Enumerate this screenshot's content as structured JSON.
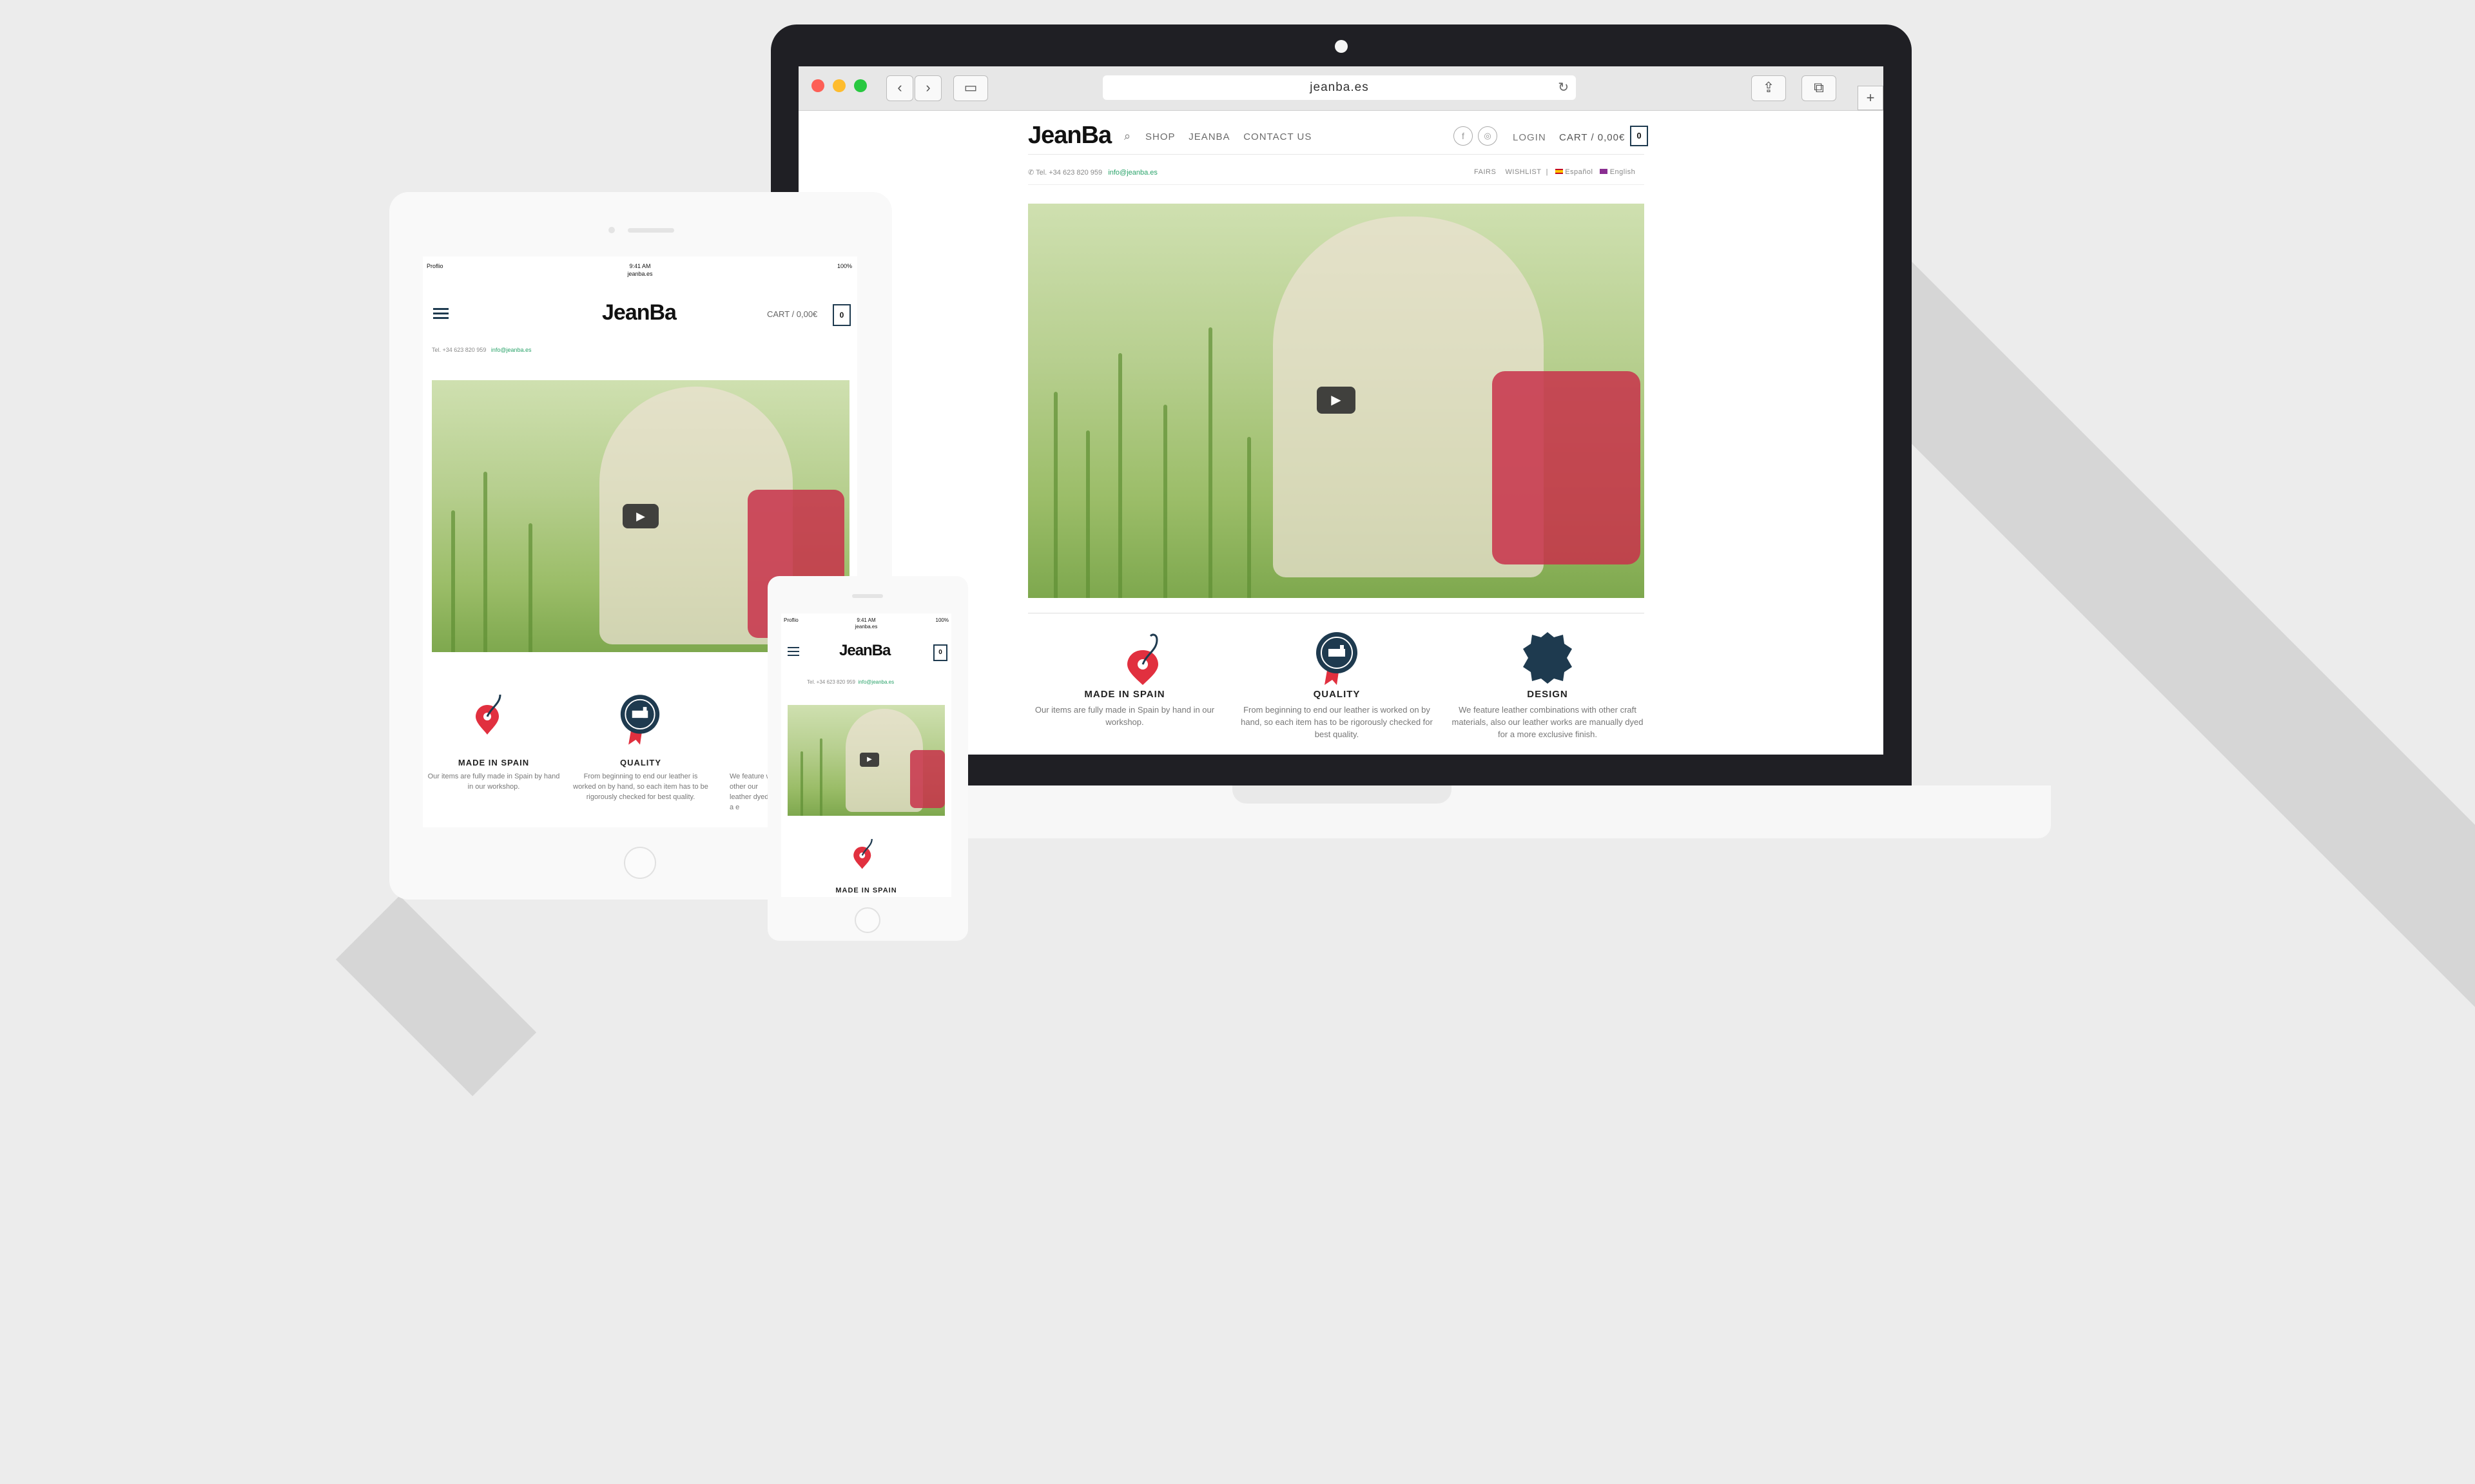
{
  "browser": {
    "url": "jeanba.es",
    "traffic_colors": [
      "#fd5f56",
      "#febc2e",
      "#28c840"
    ]
  },
  "site": {
    "logo": "JeanBa",
    "nav": [
      "SHOP",
      "JEANBA",
      "CONTACT US"
    ],
    "login": "LOGIN",
    "cart_label": "CART / 0,00€",
    "cart_count": "0",
    "phone": "Tel. +34 623 820 959",
    "email": "info@jeanba.es",
    "topbar_links": [
      "FAIRS",
      "WISHLIST"
    ],
    "languages": [
      "Español",
      "English"
    ],
    "features": [
      {
        "icon": "map-pin-needle-icon",
        "title": "MADE IN SPAIN",
        "text": "Our items are fully made in Spain by hand in our workshop."
      },
      {
        "icon": "sewing-badge-icon",
        "title": "QUALITY",
        "text": "From beginning to end our leather is worked on by hand, so each item has to be rigorously checked for best quality."
      },
      {
        "icon": "leather-hide-icon",
        "title": "DESIGN",
        "text": "We feature leather combinations with other craft materials, also our leather works are manually dyed for a more exclusive finish."
      }
    ],
    "tablet_features_text": [
      "Our items are fully made in Spain by hand in our workshop.",
      "From beginning to end our leather is worked on by hand, so each item has to be rigorously checked for best quality.",
      "We feature with other our leather dyed for a e"
    ]
  },
  "status": {
    "carrier": "Proflio",
    "time": "9:41 AM",
    "domain": "jeanba.es",
    "battery": "100%"
  },
  "colors": {
    "accent_green": "#2aa36a",
    "dark_navy": "#1e3a4f",
    "pin_red": "#e1303f"
  }
}
